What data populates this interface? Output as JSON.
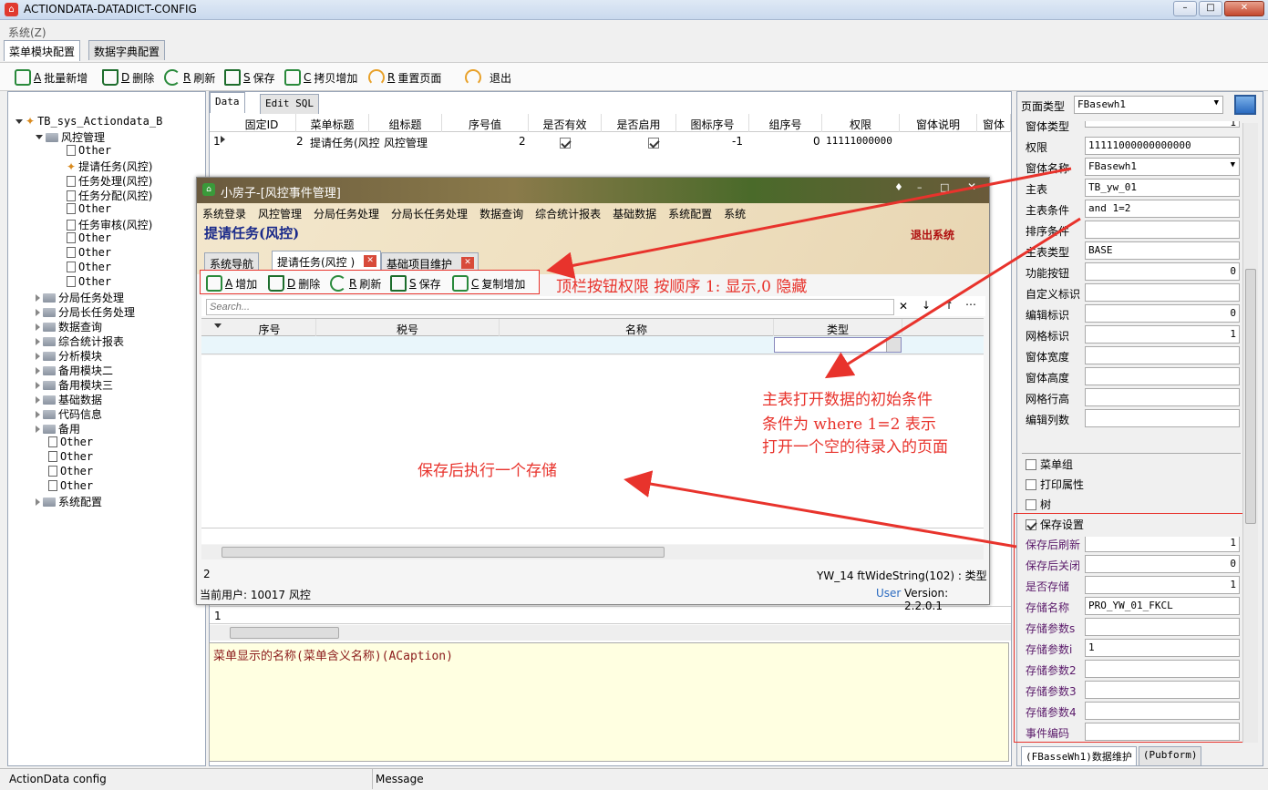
{
  "window": {
    "title": "ACTIONDATA-DATADICT-CONFIG",
    "min": "–",
    "max": "□",
    "close": "✕"
  },
  "menu": {
    "system": "系统(Z)"
  },
  "tabs": [
    "菜单模块配置",
    "数据字典配置"
  ],
  "toolbar": {
    "batch_add_key": "A",
    "batch_add": "批量新增",
    "delete_key": "D",
    "delete": "删除",
    "refresh_key": "R",
    "refresh": "刷新",
    "save_key": "S",
    "save": "保存",
    "copy_add_key": "C",
    "copy_add": "拷贝增加",
    "reset_key": "R",
    "reset": "重置页面",
    "exit": "退出"
  },
  "tree": {
    "root": "TB_sys_Actiondata_B",
    "n1": "风控管理",
    "n1_1": "Other",
    "n1_2": "提请任务(风控)",
    "n1_3": "任务处理(风控)",
    "n1_4": "任务分配(风控)",
    "n1_5": "Other",
    "n1_6": "任务审核(风控)",
    "n1_7": "Other",
    "n1_8": "Other",
    "n1_9": "Other",
    "n1_10": "Other",
    "n2": "分局任务处理",
    "n3": "分局长任务处理",
    "n4": "数据查询",
    "n5": "综合统计报表",
    "n6": "分析模块",
    "n7": "备用模块二",
    "n8": "备用模块三",
    "n9": "基础数据",
    "n10": "代码信息",
    "n11": "备用",
    "n12": "Other",
    "n13": "Other",
    "n14": "Other",
    "n15": "Other",
    "n16": "系统配置"
  },
  "mid": {
    "tab_data": "Data",
    "tab_sql": "Edit SQL",
    "headers": [
      "固定ID",
      "菜单标题",
      "组标题",
      "序号值",
      "是否有效",
      "是否启用",
      "图标序号",
      "组序号",
      "权限",
      "窗体说明",
      "窗体"
    ],
    "row": {
      "idx": "1",
      "id": "2",
      "title": "提请任务(风控",
      "group": "风控管理",
      "seq": "2",
      "icon": "-1",
      "gseq": "0",
      "perm": "11111000000"
    },
    "bottom_row": "1",
    "memo": "菜单显示的名称(菜单含义名称)(ACaption)"
  },
  "inner": {
    "title": "小房子-[风控事件管理]",
    "menus": [
      "系统登录",
      "风控管理",
      "分局任务处理",
      "分局长任务处理",
      "数据查询",
      "综合统计报表",
      "基础数据",
      "系统配置",
      "系统"
    ],
    "heading": "提请任务(风控)",
    "logout": "退出系统",
    "tabs": [
      "系统导航",
      "提请任务(风控 )",
      "基础项目维护"
    ],
    "tb": {
      "add_key": "A",
      "add": "增加",
      "del_key": "D",
      "del": "删除",
      "ref_key": "R",
      "ref": "刷新",
      "save_key": "S",
      "save": "保存",
      "copy_key": "C",
      "copy": "复制增加"
    },
    "search": "Search...",
    "cols": [
      "序号",
      "税号",
      "名称",
      "类型"
    ],
    "count": "2",
    "fieldinfo": "YW_14 ftWideString(102) : 类型",
    "user": "当前用户: 10017 风控",
    "role": "User",
    "version": "Version: 2.2.0.1"
  },
  "right": {
    "page_type_label": "页面类型",
    "page_type": "FBasewh1",
    "cut_label": "窗体类型",
    "cut_val": "1",
    "f_perm": "权限",
    "v_perm": "11111000000000000",
    "f_form": "窗体名称",
    "v_form": "FBasewh1",
    "f_table": "主表",
    "v_table": "TB_yw_01",
    "f_cond": "主表条件",
    "v_cond": "and 1=2",
    "f_sort": "排序条件",
    "v_sort": "",
    "f_ttype": "主表类型",
    "v_ttype": "BASE",
    "f_btn": "功能按钮",
    "v_btn": "0",
    "f_custom": "自定义标识",
    "v_custom": "",
    "f_edit": "编辑标识",
    "v_edit": "0",
    "f_grid": "网格标识",
    "v_grid": "1",
    "f_w": "窗体宽度",
    "f_h": "窗体高度",
    "f_rowh": "网格行高",
    "f_cols": "编辑列数",
    "g_menu": "菜单组",
    "g_print": "打印属性",
    "g_tree": "树",
    "g_save": "保存设置",
    "s_refresh": "保存后刷新",
    "v_refresh": "1",
    "s_close": "保存后关闭",
    "v_close": "0",
    "s_isproc": "是否存储",
    "v_isproc": "1",
    "s_proc": "存储名称",
    "v_proc": "PRO_YW_01_FKCL",
    "s_ps": "存储参数s",
    "s_pi": "存储参数i",
    "v_pi": "1",
    "s_p2": "存储参数2",
    "s_p3": "存储参数3",
    "s_p4": "存储参数4",
    "s_ev": "事件编码",
    "btab1": "(FBasseWh1)数据维护",
    "btab2": "(Pubform)"
  },
  "annotations": {
    "a1": "顶栏按钮权限 按顺序 1: 显示,0 隐藏",
    "a2_1": "主表打开数据的初始条件",
    "a2_2": "条件为 where 1=2 表示",
    "a2_3": "打开一个空的待录入的页面",
    "a3": "保存后执行一个存储"
  },
  "status": {
    "left": "ActionData  config",
    "msg": "Message"
  },
  "colors": {
    "accent_red": "#e8332c",
    "memo_bg": "#ffffe1"
  }
}
